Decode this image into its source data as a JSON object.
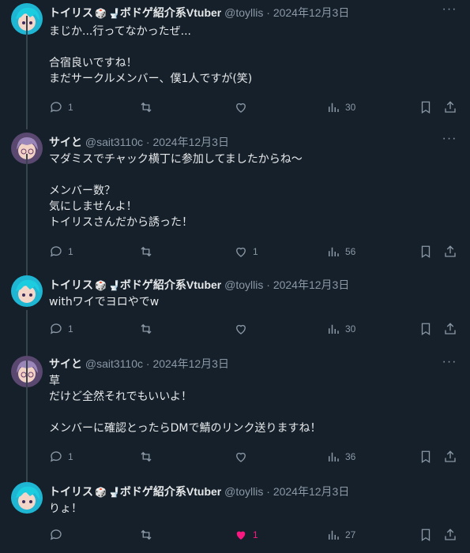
{
  "tweets": [
    {
      "author": "トイリス",
      "author_suffix": "ボドゲ紹介系Vtuber",
      "handle": "@toyllis",
      "date": "2024年12月3日",
      "lines": [
        "まじか...行ってなかったぜ...",
        "",
        "合宿良いですね！",
        "まだサークルメンバー、僕1人ですが(笑)"
      ],
      "replies": "1",
      "likes": "",
      "views": "30",
      "liked": false
    },
    {
      "author": "サイと",
      "author_suffix": "",
      "handle": "@sait3110c",
      "date": "2024年12月3日",
      "lines": [
        "マダミスでチャック横丁に参加してましたからね〜",
        "",
        "メンバー数？",
        "気にしませんよ！",
        "トイリスさんだから誘った！"
      ],
      "replies": "1",
      "likes": "1",
      "views": "56",
      "liked": false
    },
    {
      "author": "トイリス",
      "author_suffix": "ボドゲ紹介系Vtuber",
      "handle": "@toyllis",
      "date": "2024年12月3日",
      "lines": [
        "withワイでヨロやでw"
      ],
      "replies": "1",
      "likes": "",
      "views": "30",
      "liked": false
    },
    {
      "author": "サイと",
      "author_suffix": "",
      "handle": "@sait3110c",
      "date": "2024年12月3日",
      "lines": [
        "草",
        "だけど全然それでもいいよ！",
        "",
        "メンバーに確認とったらDMで鯖のリンク送りますね！"
      ],
      "replies": "1",
      "likes": "",
      "views": "36",
      "liked": false
    },
    {
      "author": "トイリス",
      "author_suffix": "ボドゲ紹介系Vtuber",
      "handle": "@toyllis",
      "date": "2024年12月3日",
      "lines": [
        "りょ！"
      ],
      "replies": "",
      "likes": "1",
      "views": "27",
      "liked": true
    }
  ],
  "separator": "·",
  "colors": {
    "bg": "#15202b",
    "text": "#e7e9ea",
    "muted": "#8b98a5",
    "like": "#f91880"
  }
}
